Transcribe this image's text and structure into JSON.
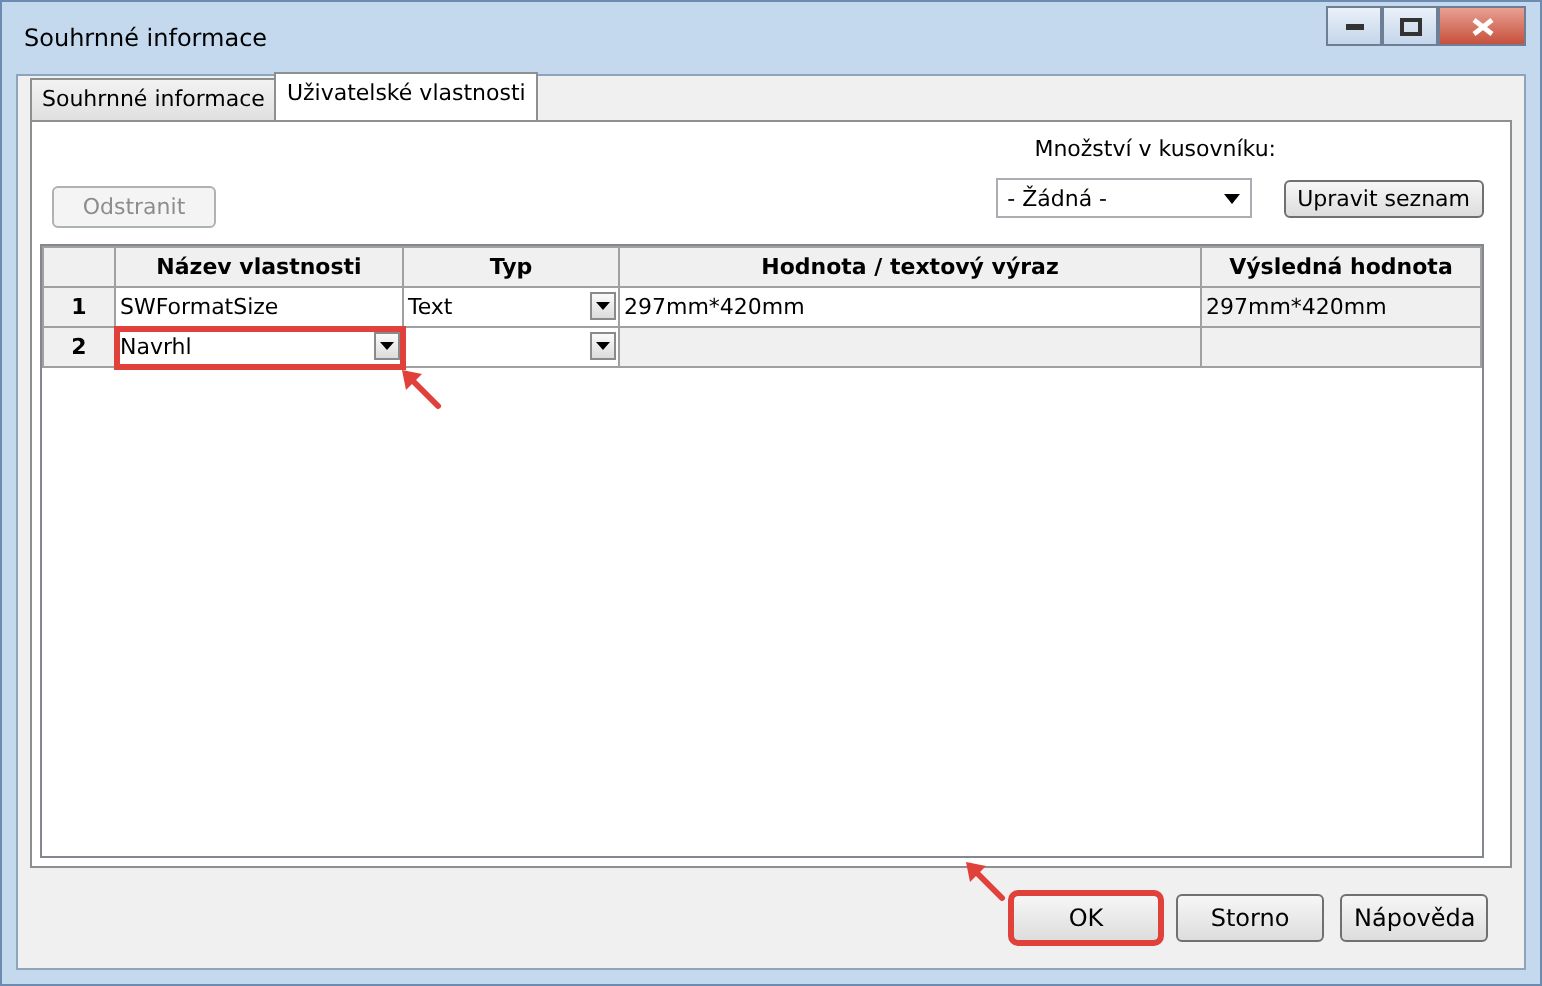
{
  "window": {
    "title": "Souhrnné informace"
  },
  "tabs": [
    {
      "label": "Souhrnné informace",
      "selected": false
    },
    {
      "label": "Uživatelské vlastnosti",
      "selected": true
    }
  ],
  "delete_button": {
    "label": "Odstranit",
    "disabled": true
  },
  "bom_quantity": {
    "label": "Množství v kusovníku:",
    "value": "- Žádná -"
  },
  "edit_list_button": {
    "label": "Upravit seznam"
  },
  "table": {
    "columns": [
      "Název vlastnosti",
      "Typ",
      "Hodnota / textový výraz",
      "Výsledná hodnota"
    ],
    "rows": [
      {
        "number": "1",
        "name": "SWFormatSize",
        "name_highlighted": false,
        "type": "Text",
        "value": "297mm*420mm",
        "result": "297mm*420mm"
      },
      {
        "number": "2",
        "name": "Navrhl",
        "name_highlighted": true,
        "type": "",
        "value": "",
        "result": ""
      }
    ]
  },
  "buttons": [
    {
      "label": "OK",
      "highlighted": true
    },
    {
      "label": "Storno",
      "highlighted": false
    },
    {
      "label": "Nápověda",
      "highlighted": false
    }
  ]
}
